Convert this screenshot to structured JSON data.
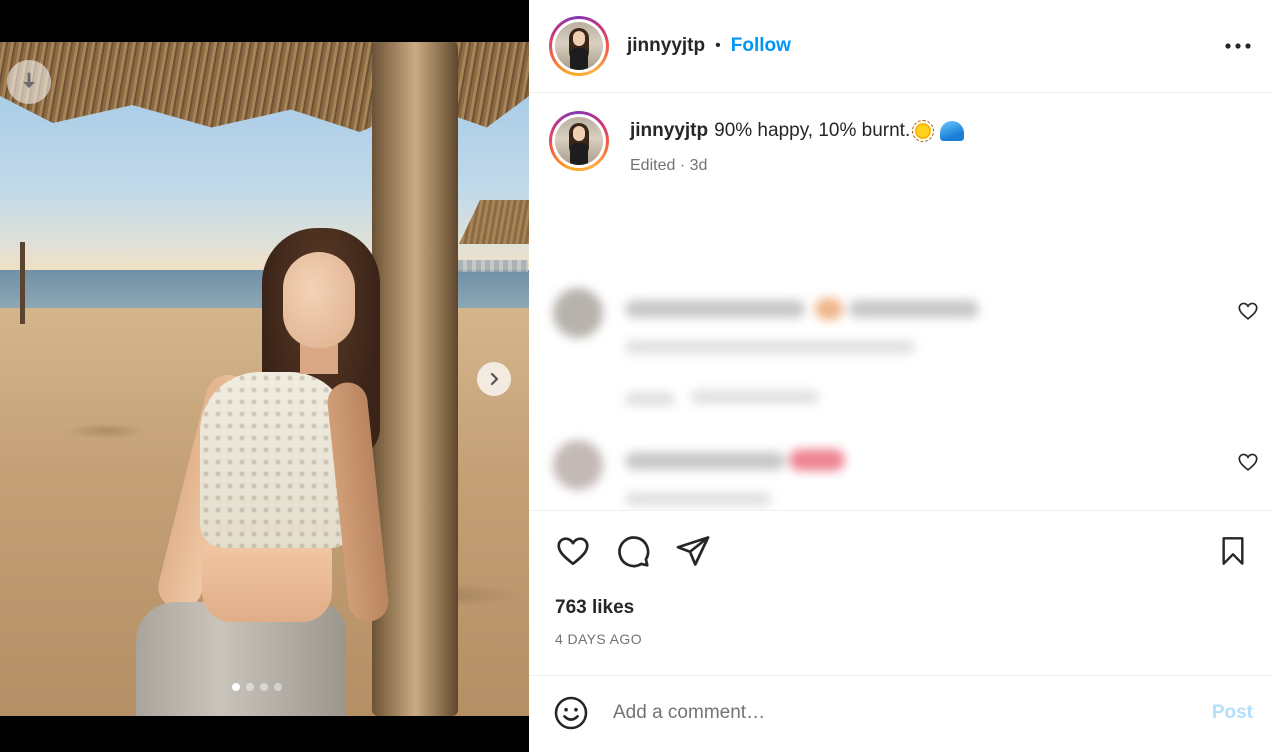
{
  "post": {
    "username": "jinnyyjtp",
    "follow_label": "Follow",
    "separator": "•",
    "caption_text": "90% happy, 10% burnt.",
    "caption_meta": "Edited · 3d",
    "likes": "763 likes",
    "date": "4 DAYS AGO",
    "comment_placeholder": "Add a comment…",
    "post_label": "Post",
    "carousel": {
      "slides": 4,
      "active": 1
    }
  },
  "icons": {
    "download": "download-arrow-icon",
    "next": "chevron-right-icon",
    "more": "more-horizontal-icon",
    "like": "heart-icon",
    "comment": "comment-bubble-icon",
    "share": "paper-plane-icon",
    "save": "bookmark-icon",
    "emoji": "smiley-icon"
  },
  "colors": {
    "accent": "#0095f6",
    "post_disabled": "#b2dffc",
    "muted": "#737373",
    "text": "#262626"
  }
}
